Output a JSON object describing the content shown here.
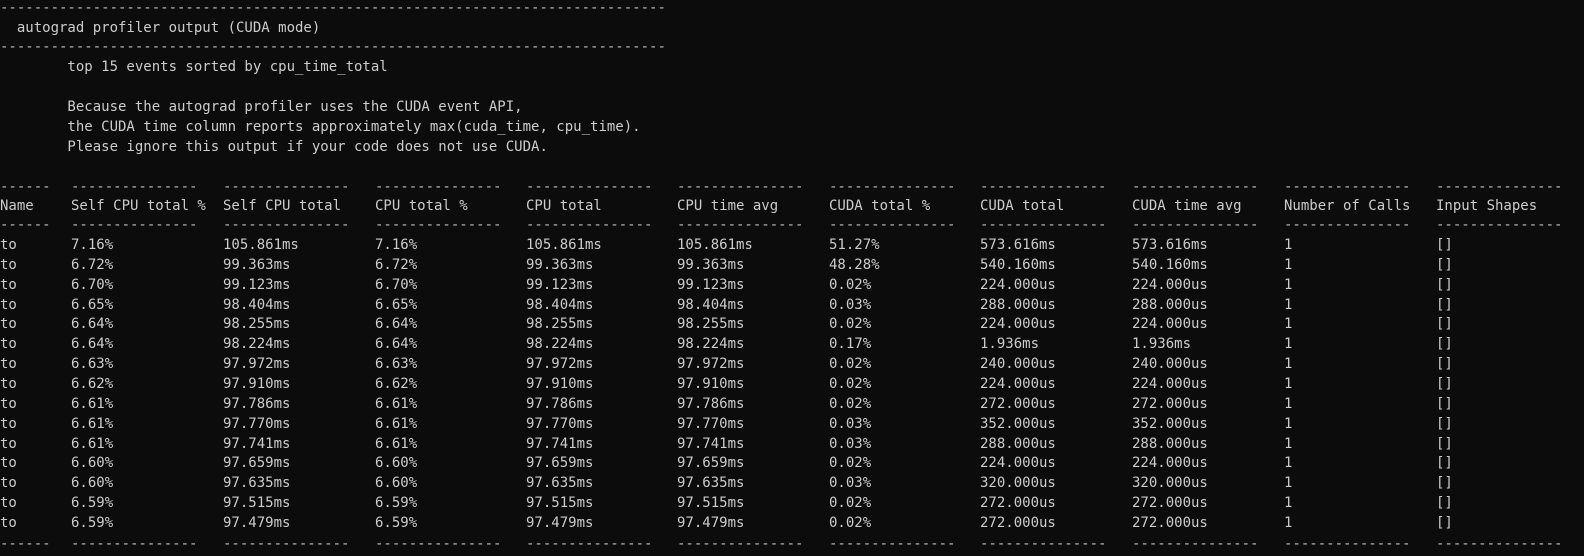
{
  "top_rule": "-------------------------------------------------------------------------------",
  "title_line": "  autograd profiler output (CUDA mode)",
  "mid_rule": "-------------------------------------------------------------------------------",
  "info": {
    "sort_line": "        top 15 events sorted by cpu_time_total",
    "note_1": "        Because the autograd profiler uses the CUDA event API,",
    "note_2": "        the CUDA time column reports approximately max(cuda_time, cpu_time).",
    "note_3": "        Please ignore this output if your code does not use CUDA."
  },
  "table": {
    "separators": [
      "------",
      "---------------",
      "---------------",
      "---------------",
      "---------------",
      "---------------",
      "---------------",
      "---------------",
      "---------------",
      "---------------",
      "---------------"
    ],
    "headers": [
      "Name",
      "Self CPU total %",
      "Self CPU total",
      "CPU total %",
      "CPU total",
      "CPU time avg",
      "CUDA total %",
      "CUDA total",
      "CUDA time avg",
      "Number of Calls",
      "Input Shapes"
    ],
    "rows": [
      [
        "to",
        "7.16%",
        "105.861ms",
        "7.16%",
        "105.861ms",
        "105.861ms",
        "51.27%",
        "573.616ms",
        "573.616ms",
        "1",
        "[]"
      ],
      [
        "to",
        "6.72%",
        "99.363ms",
        "6.72%",
        "99.363ms",
        "99.363ms",
        "48.28%",
        "540.160ms",
        "540.160ms",
        "1",
        "[]"
      ],
      [
        "to",
        "6.70%",
        "99.123ms",
        "6.70%",
        "99.123ms",
        "99.123ms",
        "0.02%",
        "224.000us",
        "224.000us",
        "1",
        "[]"
      ],
      [
        "to",
        "6.65%",
        "98.404ms",
        "6.65%",
        "98.404ms",
        "98.404ms",
        "0.03%",
        "288.000us",
        "288.000us",
        "1",
        "[]"
      ],
      [
        "to",
        "6.64%",
        "98.255ms",
        "6.64%",
        "98.255ms",
        "98.255ms",
        "0.02%",
        "224.000us",
        "224.000us",
        "1",
        "[]"
      ],
      [
        "to",
        "6.64%",
        "98.224ms",
        "6.64%",
        "98.224ms",
        "98.224ms",
        "0.17%",
        "1.936ms",
        "1.936ms",
        "1",
        "[]"
      ],
      [
        "to",
        "6.63%",
        "97.972ms",
        "6.63%",
        "97.972ms",
        "97.972ms",
        "0.02%",
        "240.000us",
        "240.000us",
        "1",
        "[]"
      ],
      [
        "to",
        "6.62%",
        "97.910ms",
        "6.62%",
        "97.910ms",
        "97.910ms",
        "0.02%",
        "224.000us",
        "224.000us",
        "1",
        "[]"
      ],
      [
        "to",
        "6.61%",
        "97.786ms",
        "6.61%",
        "97.786ms",
        "97.786ms",
        "0.02%",
        "272.000us",
        "272.000us",
        "1",
        "[]"
      ],
      [
        "to",
        "6.61%",
        "97.770ms",
        "6.61%",
        "97.770ms",
        "97.770ms",
        "0.03%",
        "352.000us",
        "352.000us",
        "1",
        "[]"
      ],
      [
        "to",
        "6.61%",
        "97.741ms",
        "6.61%",
        "97.741ms",
        "97.741ms",
        "0.03%",
        "288.000us",
        "288.000us",
        "1",
        "[]"
      ],
      [
        "to",
        "6.60%",
        "97.659ms",
        "6.60%",
        "97.659ms",
        "97.659ms",
        "0.02%",
        "224.000us",
        "224.000us",
        "1",
        "[]"
      ],
      [
        "to",
        "6.60%",
        "97.635ms",
        "6.60%",
        "97.635ms",
        "97.635ms",
        "0.03%",
        "320.000us",
        "320.000us",
        "1",
        "[]"
      ],
      [
        "to",
        "6.59%",
        "97.515ms",
        "6.59%",
        "97.515ms",
        "97.515ms",
        "0.02%",
        "272.000us",
        "272.000us",
        "1",
        "[]"
      ],
      [
        "to",
        "6.59%",
        "97.479ms",
        "6.59%",
        "97.479ms",
        "97.479ms",
        "0.02%",
        "272.000us",
        "272.000us",
        "1",
        "[]"
      ]
    ]
  }
}
